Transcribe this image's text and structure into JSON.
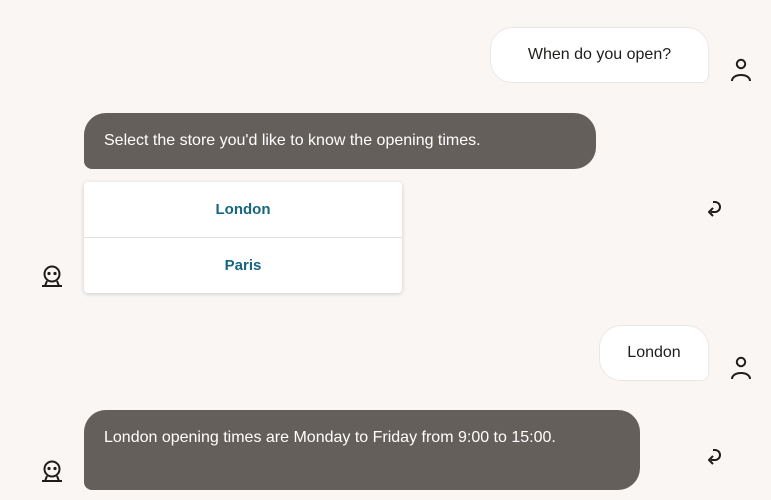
{
  "messages": {
    "user_1": "When do you open?",
    "bot_1": "Select the store you'd like to know the opening times.",
    "options": [
      {
        "label": "London"
      },
      {
        "label": "Paris"
      }
    ],
    "user_2": "London",
    "bot_2": "London opening times are Monday to Friday from 9:00 to 15:00."
  },
  "icons": {
    "user_avatar": "user-icon",
    "bot_avatar": "bot-icon",
    "action": "reply-arrow-icon"
  },
  "colors": {
    "background": "#faf6f4",
    "bot_bubble": "#655f5b",
    "user_bubble": "#ffffff",
    "option_text": "#15667f"
  }
}
